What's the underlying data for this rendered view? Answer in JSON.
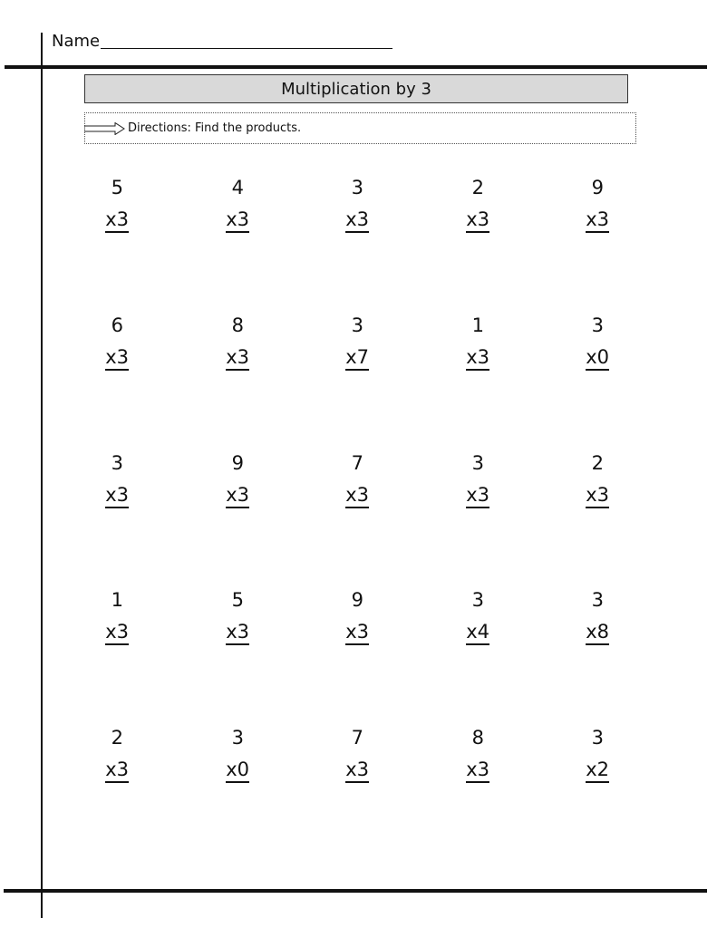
{
  "header": {
    "name_label": "Name"
  },
  "title": "Multiplication by 3",
  "directions": {
    "icon": "arrow-right-icon",
    "text": "Directions: Find the products."
  },
  "problems": [
    [
      {
        "top": "5",
        "mult": "x3"
      },
      {
        "top": "4",
        "mult": "x3"
      },
      {
        "top": "3",
        "mult": "x3"
      },
      {
        "top": "2",
        "mult": "x3"
      },
      {
        "top": "9",
        "mult": "x3"
      }
    ],
    [
      {
        "top": "6",
        "mult": "x3"
      },
      {
        "top": "8",
        "mult": "x3"
      },
      {
        "top": "3",
        "mult": "x7"
      },
      {
        "top": "1",
        "mult": "x3"
      },
      {
        "top": "3",
        "mult": "x0"
      }
    ],
    [
      {
        "top": "3",
        "mult": "x3"
      },
      {
        "top": "9",
        "mult": "x3"
      },
      {
        "top": "7",
        "mult": "x3"
      },
      {
        "top": "3",
        "mult": "x3"
      },
      {
        "top": "2",
        "mult": "x3"
      }
    ],
    [
      {
        "top": "1",
        "mult": "x3"
      },
      {
        "top": "5",
        "mult": "x3"
      },
      {
        "top": "9",
        "mult": "x3"
      },
      {
        "top": "3",
        "mult": "x4"
      },
      {
        "top": "3",
        "mult": "x8"
      }
    ],
    [
      {
        "top": "2",
        "mult": "x3"
      },
      {
        "top": "3",
        "mult": "x0"
      },
      {
        "top": "7",
        "mult": "x3"
      },
      {
        "top": "8",
        "mult": "x3"
      },
      {
        "top": "3",
        "mult": "x2"
      }
    ]
  ]
}
